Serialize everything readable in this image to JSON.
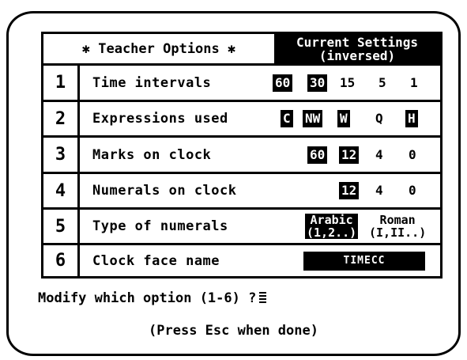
{
  "header": {
    "title_left": "✱ Teacher Options ✱",
    "title_right_line1": "Current Settings",
    "title_right_line2": "(inversed)"
  },
  "options": [
    {
      "number": "1",
      "label": "Time intervals",
      "values": [
        {
          "text": "60",
          "inversed": true
        },
        {
          "text": "30",
          "inversed": true
        },
        {
          "text": "15",
          "inversed": false
        },
        {
          "text": "5",
          "inversed": false
        },
        {
          "text": "1",
          "inversed": false
        }
      ]
    },
    {
      "number": "2",
      "label": "Expressions used",
      "values": [
        {
          "text": "C",
          "inversed": true
        },
        {
          "text": "NW",
          "inversed": true
        },
        {
          "text": "W",
          "inversed": true
        },
        {
          "text": "Q",
          "inversed": false
        },
        {
          "text": "H",
          "inversed": true
        }
      ]
    },
    {
      "number": "3",
      "label": "Marks on clock",
      "values": [
        {
          "text": "60",
          "inversed": true
        },
        {
          "text": "12",
          "inversed": true
        },
        {
          "text": "4",
          "inversed": false
        },
        {
          "text": "0",
          "inversed": false
        }
      ]
    },
    {
      "number": "4",
      "label": "Numerals on clock",
      "values": [
        {
          "text": "12",
          "inversed": true
        },
        {
          "text": "4",
          "inversed": false
        },
        {
          "text": "0",
          "inversed": false
        }
      ]
    },
    {
      "number": "5",
      "label": "Type of numerals",
      "values": [
        {
          "line1": "Arabic",
          "line2": "(1,2..)",
          "inversed": true
        },
        {
          "line1": "Roman",
          "line2": "(I,II..)",
          "inversed": false
        }
      ]
    },
    {
      "number": "6",
      "label": "Clock face name",
      "values": [
        {
          "text": "TIMECC",
          "inversed": true
        }
      ]
    }
  ],
  "prompt": "Modify which option (1-6) ?",
  "hint": "(Press Esc when done)",
  "colors": {
    "background": "#ffffff",
    "foreground": "#000000"
  }
}
